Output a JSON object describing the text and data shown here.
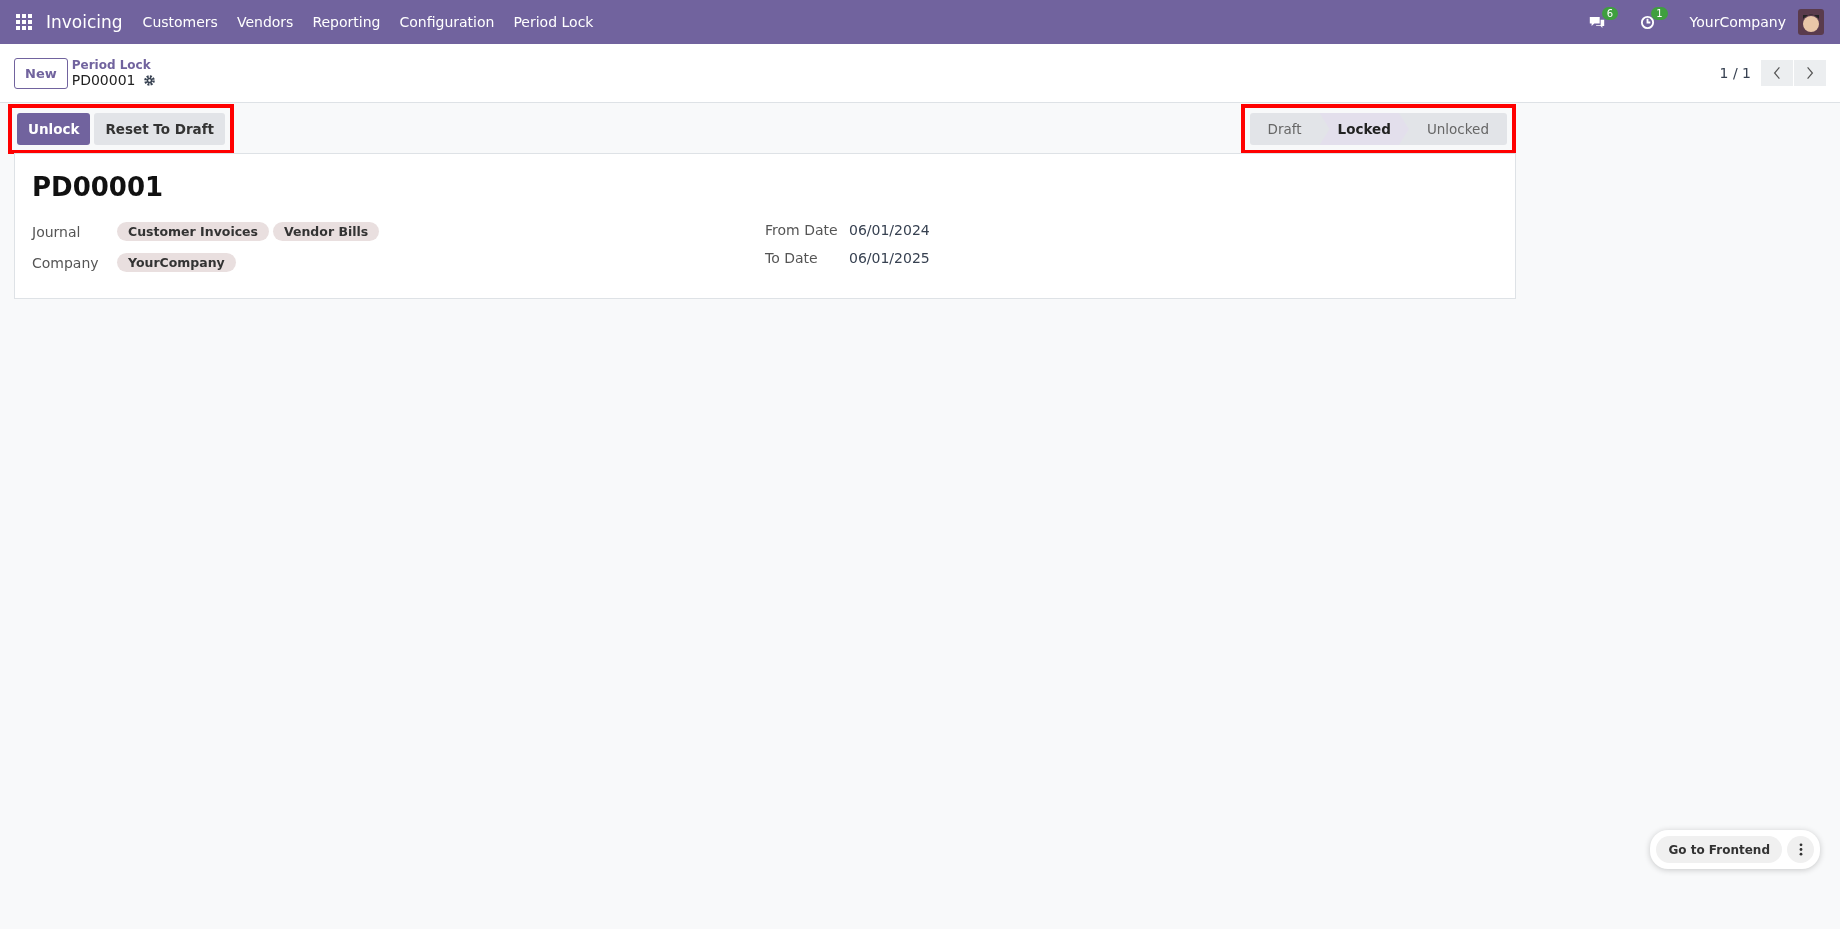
{
  "navbar": {
    "app": "Invoicing",
    "menus": [
      "Customers",
      "Vendors",
      "Reporting",
      "Configuration",
      "Period Lock"
    ],
    "messages_count": "6",
    "activities_count": "1",
    "company": "YourCompany"
  },
  "control_panel": {
    "new_button": "New",
    "breadcrumb": "Period Lock",
    "record": "PD00001",
    "pager": "1 / 1"
  },
  "actions": [
    {
      "label": "Unlock",
      "kind": "primary"
    },
    {
      "label": "Reset To Draft",
      "kind": "secondary"
    }
  ],
  "stages": [
    {
      "label": "Draft",
      "selected": false
    },
    {
      "label": "Locked",
      "selected": true
    },
    {
      "label": "Unlocked",
      "selected": false
    }
  ],
  "form": {
    "title": "PD00001",
    "left_fields": [
      {
        "label": "Journal",
        "tags": [
          "Customer Invoices",
          "Vendor Bills"
        ]
      },
      {
        "label": "Company",
        "tags": [
          "YourCompany"
        ]
      }
    ],
    "right_fields": [
      {
        "label": "From Date",
        "value": "06/01/2024"
      },
      {
        "label": "To Date",
        "value": "06/01/2025"
      }
    ]
  },
  "frontend_button": "Go to Frontend"
}
